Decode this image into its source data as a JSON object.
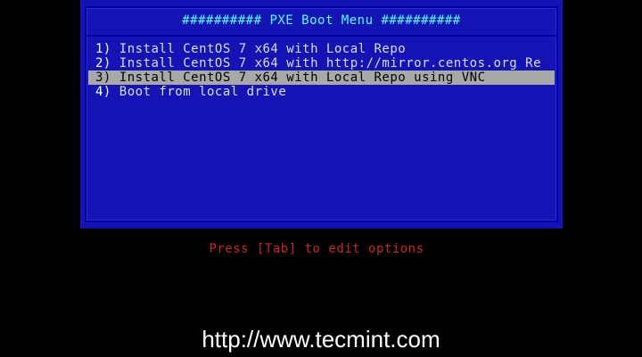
{
  "menu": {
    "title": "########## PXE Boot Menu ##########",
    "items": [
      {
        "number": "1)",
        "label": " Install CentOS 7 x64 with Local Repo",
        "selected": false
      },
      {
        "number": "2)",
        "label": " Install CentOS 7 x64 with http://mirror.centos.org Re",
        "selected": false
      },
      {
        "number": "3)",
        "label": " Install CentOS 7 x64 with Local Repo using VNC",
        "selected": true
      },
      {
        "number": "4)",
        "label": " Boot from local drive",
        "selected": false
      }
    ]
  },
  "hint": "Press [Tab] to edit options",
  "watermark": "http://www.tecmint.com",
  "colors": {
    "background": "#000000",
    "panel": "#1414b4",
    "title": "#55ffff",
    "item_text": "#dcdcdc",
    "selected_bar": "#a8a8a8",
    "hint": "#c82828"
  }
}
